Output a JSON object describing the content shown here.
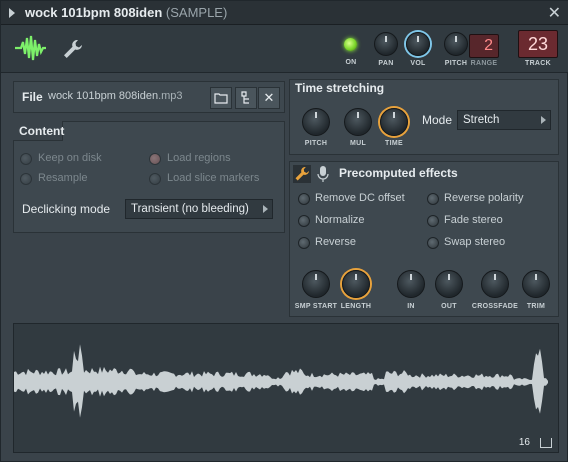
{
  "window": {
    "title": "wock 101bpm 808iden",
    "subtitle": "(SAMPLE)",
    "close_glyph": "✕"
  },
  "toolbar": {
    "wave_icon": "waveform-icon",
    "wrench_icon": "wrench-icon",
    "on_label": "ON",
    "pan_label": "PAN",
    "vol_label": "VOL",
    "pitch_label": "PITCH",
    "range_label": "RANGE",
    "range_value": "2",
    "track_label": "TRACK",
    "track_value": "23",
    "on_color": "#7bd62a"
  },
  "file": {
    "label": "File",
    "name": "wock 101bpm 808iden",
    "ext": ".mp3",
    "open_icon": "folder-icon",
    "locate_icon": "tree-icon",
    "remove_icon": "close-icon",
    "remove_glyph": "✕"
  },
  "content": {
    "title": "Content",
    "keep_on_disk": "Keep on disk",
    "resample": "Resample",
    "load_regions": "Load regions",
    "load_slice_markers": "Load slice markers",
    "declicking_label": "Declicking mode",
    "declicking_value": "Transient (no bleeding)"
  },
  "time_stretching": {
    "title": "Time stretching",
    "pitch_label": "PITCH",
    "mul_label": "MUL",
    "time_label": "TIME",
    "mode_label": "Mode",
    "mode_value": "Stretch"
  },
  "precomputed": {
    "title": "Precomputed effects",
    "remove_dc": "Remove DC offset",
    "normalize": "Normalize",
    "reverse": "Reverse",
    "reverse_polarity": "Reverse polarity",
    "fade_stereo": "Fade stereo",
    "swap_stereo": "Swap stereo",
    "knobs": [
      "SMP START",
      "LENGTH",
      "IN",
      "OUT",
      "CROSSFADE",
      "TRIM"
    ]
  },
  "waveform": {
    "label": "16",
    "color": "#c9d0d3"
  }
}
